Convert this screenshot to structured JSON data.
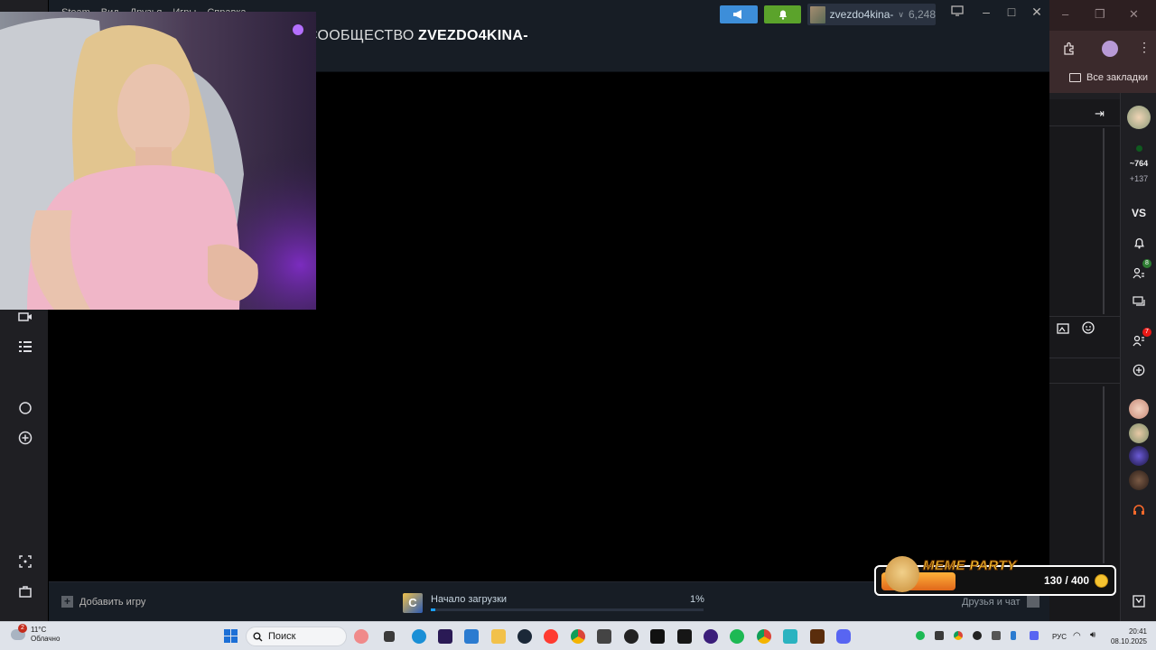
{
  "steam": {
    "menu": [
      "Steam",
      "Вид",
      "Друзья",
      "Игры",
      "Справка"
    ],
    "nav": [
      "СООБЩЕСТВО",
      "ZVEZDO4KINA-"
    ],
    "announce_icon": "megaphone-icon",
    "notify_icon": "bell-icon",
    "user": {
      "name": "zvezdo4kina-",
      "balance": "6,248"
    },
    "footer": {
      "add_game": "Добавить игру",
      "download_label": "Начало загрузки",
      "download_percent": "1%",
      "download_progress": 0.01,
      "friends_chat": "Друзья и чат"
    }
  },
  "browser": {
    "bookmarks_label": "Все закладки",
    "rail": {
      "viewers": "~764",
      "plus": "+137",
      "vs": "VS",
      "notif_badge": "8",
      "friends_badge": "7"
    }
  },
  "widget": {
    "title": "MEME PARTY",
    "count": "130 / 400",
    "progress": 0.325
  },
  "taskbar": {
    "weather_badge": "2",
    "temperature": "11°C",
    "condition": "Облачно",
    "search_placeholder": "Поиск",
    "language": "РУС",
    "time": "20:41",
    "date": "08.10.2025"
  },
  "colors": {
    "steam_header": "#171d25",
    "announce": "#3d8ed9",
    "notify": "#5ba32b",
    "progress": "#1a9fff",
    "twitch_panel": "#1f1f23"
  }
}
